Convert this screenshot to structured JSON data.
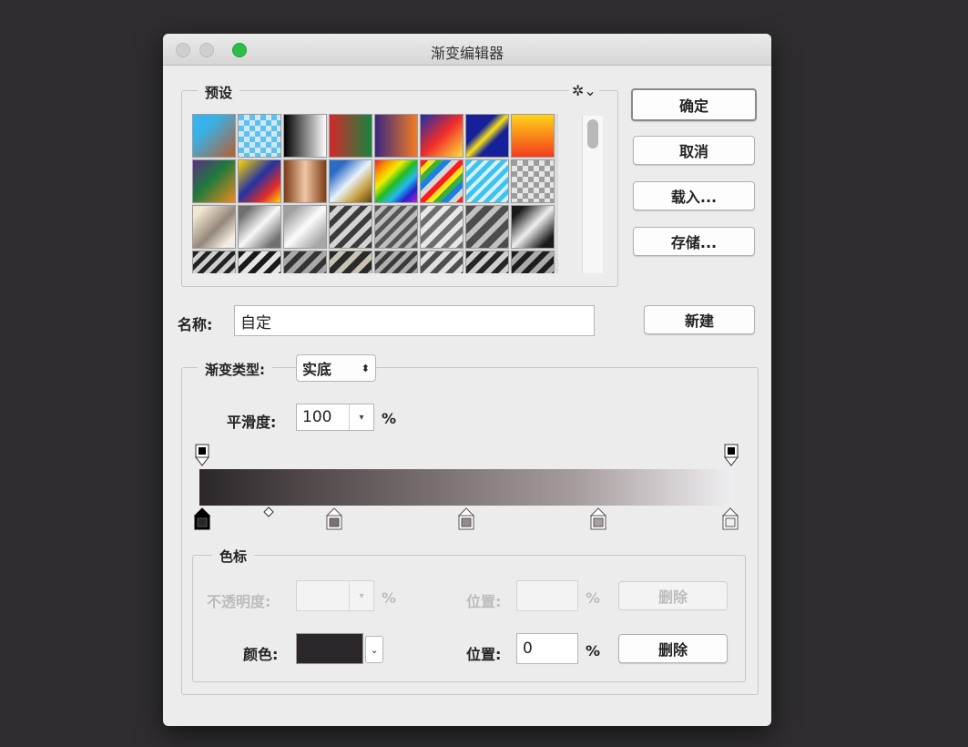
{
  "window": {
    "title": "渐变编辑器"
  },
  "presets": {
    "legend": "预设",
    "gear_icon": "gear-icon",
    "swatches": [
      "linear-gradient(135deg,#37b2ea 30%,#a36b4c 90%)",
      "repeating-conic-gradient(#cfe8f6 0 25%,#5fc0ef 0 50%) 0 0/12px 12px",
      "linear-gradient(90deg,#000 0%,#fff 100%)",
      "linear-gradient(90deg,#d6282b 0%,#16843d 100%)",
      "linear-gradient(90deg,#3a2680 0%,#f47c22 100%)",
      "linear-gradient(135deg,#1e2fa8 0%,#ef2b2b 50%,#ffe23c 100%)",
      "linear-gradient(135deg,#15209a 35%,#f5e316 50%,#15209a 65%)",
      "linear-gradient(180deg,#ffd31a 0%,#f43c1b 100%)",
      "linear-gradient(135deg,#5a2e86 0%,#1f7a3c 45%,#f08a1b 100%)",
      "linear-gradient(135deg,#ffd600 0%,#2233a0 45%,#e12c2c 75%,#ffd600 100%)",
      "linear-gradient(90deg,#7b3c17 0%,#f1c6a5 50%,#7b3c17 100%)",
      "linear-gradient(135deg,#2d6cc5 20%,#e9f2fb 50%,#c8a040 75%,#5b4315 100%)",
      "linear-gradient(135deg,#e22 0%,#f90 18%,#ee0 34%,#2b2 50%,#2be 66%,#22c 82%,#b2c 100%)",
      "repeating-linear-gradient(135deg,#ff1c1c 0 6px,#ffe51a 6px 12px,#3bb03b 12px 18px,#1c7fe4 18px 24px,#d7d7d7 24px 30px)",
      "repeating-linear-gradient(135deg,#3cc3ef 0 5px,#d8f1fb 5px 9px)",
      "repeating-conic-gradient(#e5e5e5 0 25%,#9c9c9c 0 50%) 0 0/12px 12px",
      "linear-gradient(135deg,#f0e6d1 15%,#95877a 55%,#f3ede3 85%)",
      "linear-gradient(135deg,#6f6f6f 15%,#f8f8f8 50%,#707070 85%)",
      "linear-gradient(135deg,#9f9f9f 15%,#fcfcfc 50%,#a7a7a7 85%)",
      "repeating-linear-gradient(135deg,#3b3b3b 0 6px,#d3d3d3 6px 12px)",
      "repeating-linear-gradient(135deg,#555 0 5px,#bdbdbd 5px 10px)",
      "repeating-linear-gradient(135deg,#6d6d6d 0 6px,#e7e7e7 6px 12px)",
      "repeating-linear-gradient(135deg,#4d4d4d 0 8px,#c1c1c1 8px 14px)",
      "linear-gradient(135deg,#1a1a1a 15%,#efefef 50%,#1a1a1a 85%)",
      "repeating-linear-gradient(135deg,#222 0 5px,#cfcfcf 5px 10px)",
      "repeating-linear-gradient(135deg,#1a1a1a 0 6px,#e5e5e5 6px 12px)",
      "repeating-linear-gradient(135deg,#333 0 6px,#a8a8a8 6px 12px)",
      "repeating-linear-gradient(135deg,#2a2a2a 0 7px,#c9c3b3 7px 13px)",
      "repeating-linear-gradient(135deg,#3a3a3a 0 5px,#b0b0b0 5px 10px)",
      "repeating-linear-gradient(135deg,#4d4d4d 0 6px,#e0e0e0 6px 12px)",
      "repeating-linear-gradient(135deg,#262626 0 6px,#cfcfcf 6px 12px)",
      "repeating-linear-gradient(135deg,#1d1d1d 0 6px,#ababab 6px 12px)"
    ]
  },
  "buttons": {
    "ok": "确定",
    "cancel": "取消",
    "load": "载入...",
    "save": "存储...",
    "new": "新建"
  },
  "name": {
    "label": "名称:",
    "value": "自定"
  },
  "gradient": {
    "type_label": "渐变类型:",
    "type_value": "实底",
    "smoothness_label": "平滑度:",
    "smoothness_value": "100",
    "smoothness_unit": "%"
  },
  "stops": {
    "legend": "色标",
    "opacity_label": "不透明度:",
    "opacity_value": "",
    "opacity_unit": "%",
    "opacity_position_label": "位置:",
    "opacity_position_value": "",
    "opacity_position_unit": "%",
    "opacity_delete": "删除",
    "color_label": "颜色:",
    "color_hex": "#2b2629",
    "color_position_label": "位置:",
    "color_position_value": "0",
    "color_position_unit": "%",
    "color_delete": "删除"
  }
}
